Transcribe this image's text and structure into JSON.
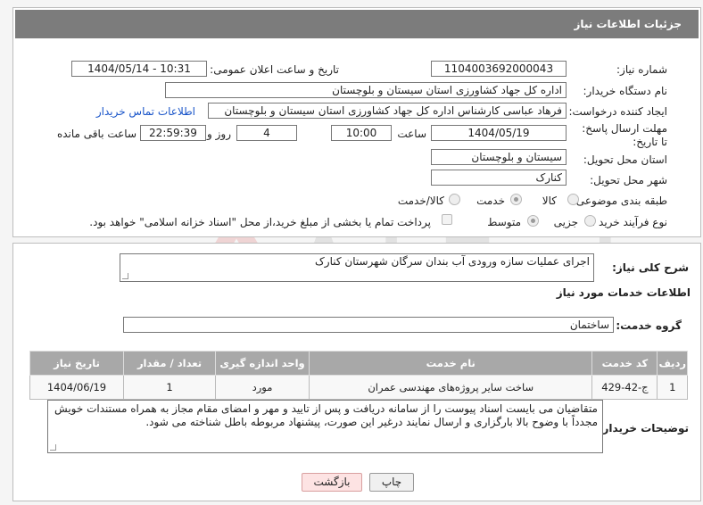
{
  "header": {
    "title": "جزئیات اطلاعات نیاز"
  },
  "labels": {
    "need_number": "شماره نیاز:",
    "announce_datetime": "تاریخ و ساعت اعلان عمومی:",
    "buyer_org": "نام دستگاه خریدار:",
    "requester": "ایجاد کننده درخواست:",
    "deadline": "مهلت ارسال پاسخ: تا تاریخ:",
    "hour": "ساعت",
    "day_and": "روز و",
    "hours_remaining": "ساعت باقی مانده",
    "province": "استان محل تحویل:",
    "city": "شهر محل تحویل:",
    "category": "طبقه بندی موضوعی:",
    "purchase_type": "نوع فرآیند خرید :",
    "general_desc": "شرح کلی نیاز:",
    "services_info": "اطلاعات خدمات مورد نیاز",
    "service_group": "گروه خدمت:",
    "buyer_notes": "توضیحات خریدار:"
  },
  "fields": {
    "need_number": "1104003692000043",
    "announce_datetime": "1404/05/14 - 10:31",
    "buyer_org": "اداره کل جهاد کشاورزی استان سیستان و بلوچستان",
    "requester": "فرهاد عباسی کارشناس  اداره کل جهاد کشاورزی استان سیستان و بلوچستان",
    "contact_link": "اطلاعات تماس خریدار",
    "deadline_date": "1404/05/19",
    "deadline_time": "10:00",
    "days": "4",
    "remaining_time": "22:59:39",
    "province": "سیستان و بلوچستان",
    "city": "کنارک",
    "general_desc": "اجرای عملیات سازه ورودی آب بندان سرگان شهرستان کنارک",
    "service_group": "ساختمان",
    "buyer_notes": "متقاضیان می بایست اسناد پیوست را از سامانه دریافت و پس از تایید و مهر و امضای مقام مجاز به همراه مستندات خویش مجدداً با وضوح بالا بارگزاری و ارسال نمایند درغیر این صورت، پیشنهاد مربوطه باطل شناخته می شود."
  },
  "category_options": {
    "goods": "کالا",
    "service": "خدمت",
    "goods_service": "کالا/خدمت",
    "selected": "خدمت"
  },
  "purchase_options": {
    "minor": "جزیی",
    "medium": "متوسط",
    "selected": "متوسط"
  },
  "treasury_note": "پرداخت تمام یا بخشی از مبلغ خرید،از محل \"اسناد خزانه اسلامی\" خواهد بود.",
  "table": {
    "headers": {
      "row": "ردیف",
      "code": "کد خدمت",
      "name": "نام خدمت",
      "unit": "واحد اندازه گیری",
      "qty": "تعداد / مقدار",
      "date": "تاریخ نیاز"
    },
    "rows": [
      {
        "row": "1",
        "code": "ج-42-429",
        "name": "ساخت سایر پروژه‌های مهندسی عمران",
        "unit": "مورد",
        "qty": "1",
        "date": "1404/06/19"
      }
    ]
  },
  "buttons": {
    "print": "چاپ",
    "back": "بازگشت"
  },
  "watermark": "AriaTender.neT"
}
